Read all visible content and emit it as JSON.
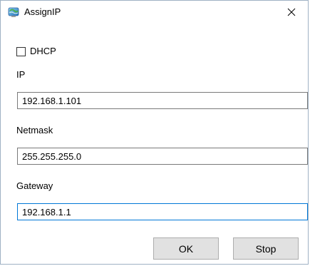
{
  "window": {
    "title": "AssignIP",
    "app_icon": "network-globe-icon",
    "close_icon": "close-icon"
  },
  "dhcp": {
    "label": "DHCP",
    "checked": false
  },
  "ip": {
    "label": "IP",
    "value": "192.168.1.101"
  },
  "netmask": {
    "label": "Netmask",
    "value": "255.255.255.0"
  },
  "gateway": {
    "label": "Gateway",
    "value": "192.168.1.1"
  },
  "buttons": {
    "ok_label": "OK",
    "stop_label": "Stop"
  },
  "colors": {
    "focus_border": "#0078d7",
    "button_face": "#e1e1e1",
    "input_border": "#7a7a7a"
  }
}
